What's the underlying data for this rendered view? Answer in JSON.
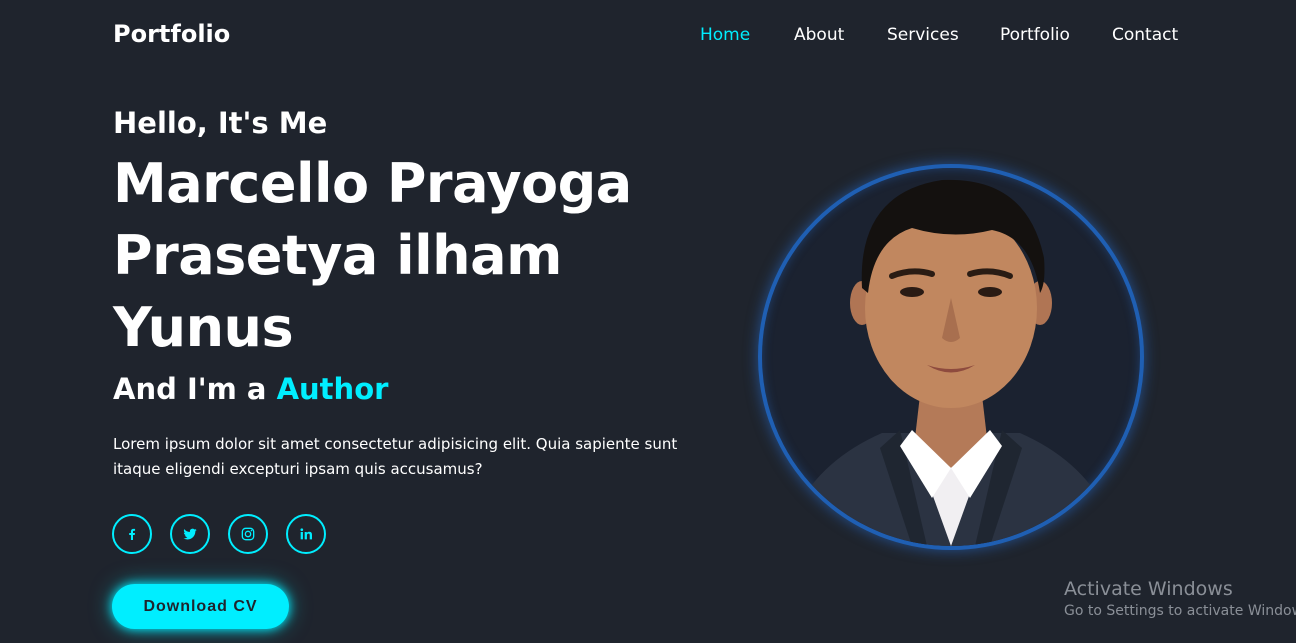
{
  "header": {
    "logo": "Portfolio",
    "nav": [
      {
        "label": "Home",
        "active": true
      },
      {
        "label": "About",
        "active": false
      },
      {
        "label": "Services",
        "active": false
      },
      {
        "label": "Portfolio",
        "active": false
      },
      {
        "label": "Contact",
        "active": false
      }
    ]
  },
  "hero": {
    "greeting": "Hello, It's Me",
    "name_lines": [
      "Marcello Prayoga",
      "Prasetya ilham",
      "Yunus"
    ],
    "role_prefix": "And I'm a ",
    "role_highlight": "Author",
    "description": "Lorem ipsum dolor sit amet consectetur adipisicing elit. Quia sapiente sunt itaque eligendi excepturi ipsam quis accusamus?",
    "social": [
      {
        "icon": "facebook-icon"
      },
      {
        "icon": "twitter-icon"
      },
      {
        "icon": "instagram-icon"
      },
      {
        "icon": "linkedin-icon"
      }
    ],
    "cta": "Download CV"
  },
  "colors": {
    "background": "#1f242d",
    "accent": "#00eeff",
    "ring": "#1f5fb3"
  },
  "watermark": {
    "title": "Activate Windows",
    "subtitle": "Go to Settings to activate Windows."
  }
}
